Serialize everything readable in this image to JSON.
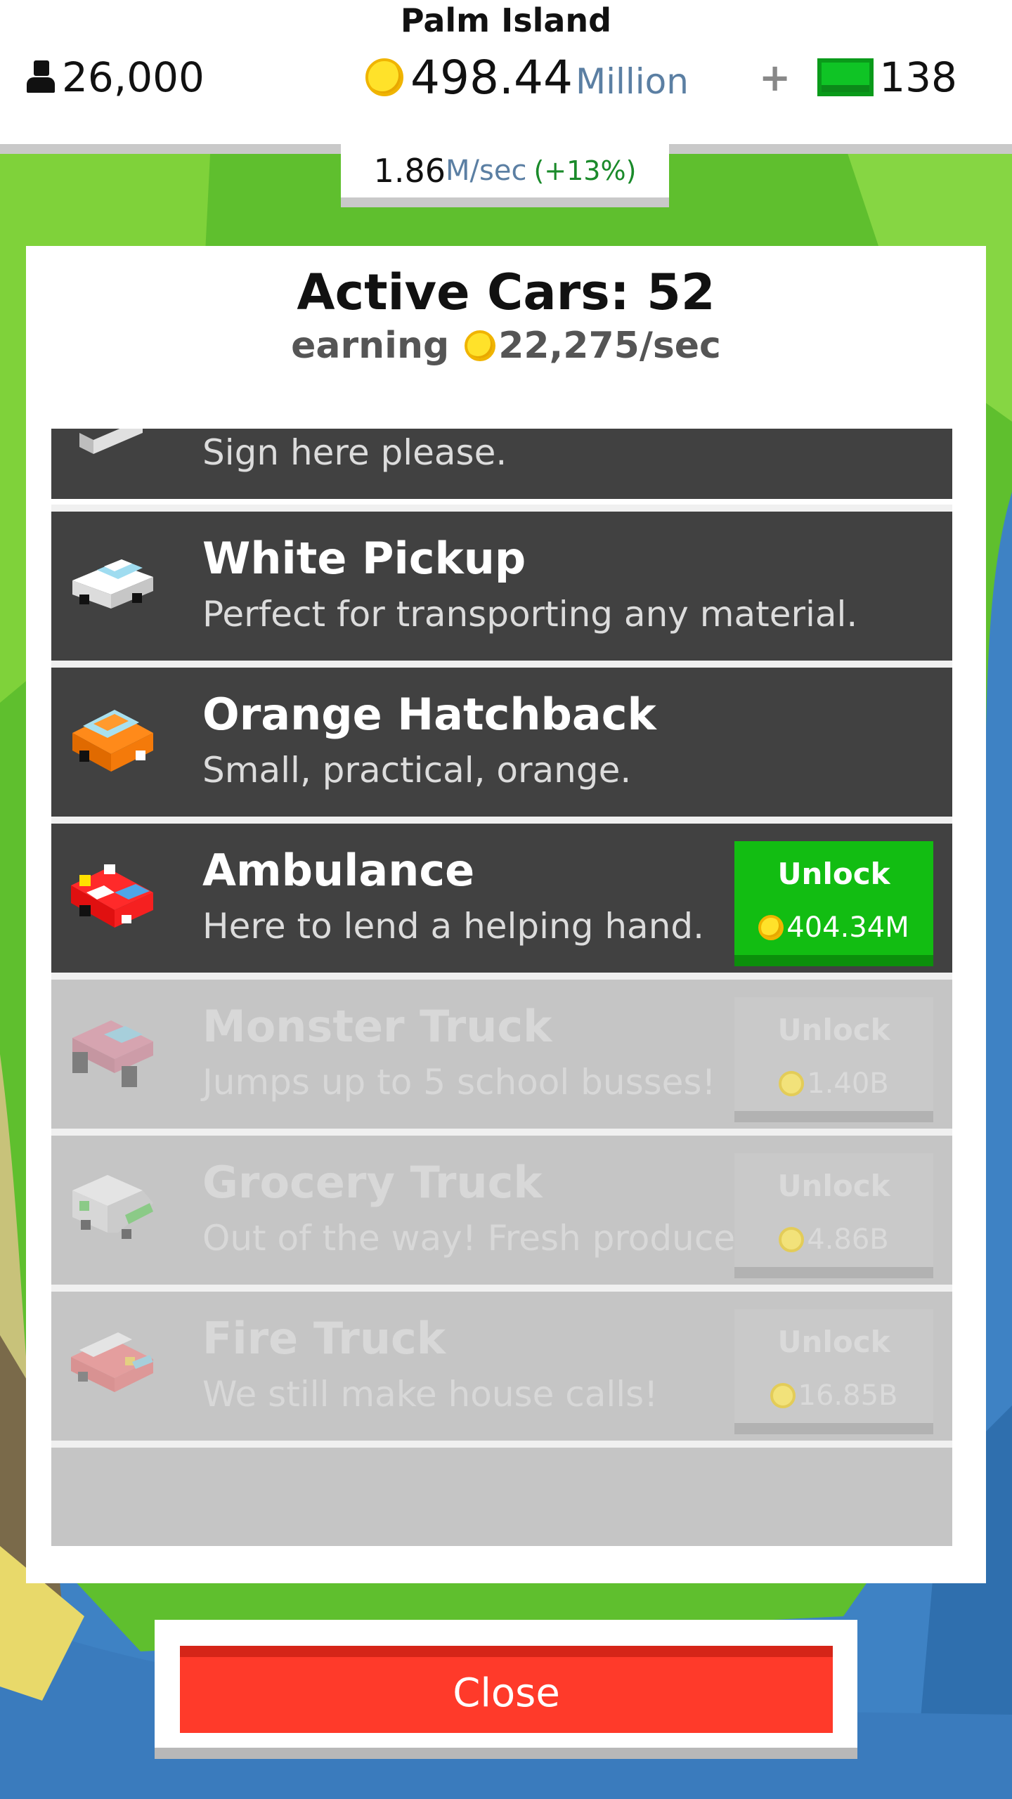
{
  "header": {
    "island_name": "Palm Island",
    "population": "26,000",
    "money_value": "498.44",
    "money_unit": "Million",
    "gems_plus": "+",
    "gems": "138"
  },
  "income": {
    "value": "1.86",
    "unit": "M/sec",
    "percent": "(+13%)"
  },
  "panel": {
    "title": "Active Cars: 52",
    "earning_label": "earning",
    "earning_value": "22,275/sec"
  },
  "cars": [
    {
      "name": "",
      "desc": "Sign here please.",
      "state": "owned",
      "icon": "sedan-icon"
    },
    {
      "name": "White Pickup",
      "desc": "Perfect for transporting any material.",
      "state": "owned",
      "icon": "white-pickup-icon"
    },
    {
      "name": "Orange Hatchback",
      "desc": "Small, practical, orange.",
      "state": "owned",
      "icon": "orange-hatchback-icon"
    },
    {
      "name": "Ambulance",
      "desc": "Here to lend a helping hand.",
      "state": "unlockable",
      "unlock_label": "Unlock",
      "price": "404.34M",
      "icon": "ambulance-icon"
    },
    {
      "name": "Monster Truck",
      "desc": "Jumps up to 5 school busses!",
      "state": "locked",
      "unlock_label": "Unlock",
      "price": "1.40B",
      "icon": "monster-truck-icon"
    },
    {
      "name": "Grocery Truck",
      "desc": "Out of the way! Fresh produce here!",
      "state": "locked",
      "unlock_label": "Unlock",
      "price": "4.86B",
      "icon": "grocery-truck-icon"
    },
    {
      "name": "Fire Truck",
      "desc": "We still make house calls!",
      "state": "locked",
      "unlock_label": "Unlock",
      "price": "16.85B",
      "icon": "fire-truck-icon"
    }
  ],
  "close_label": "Close",
  "colors": {
    "unlock_green": "#12bd12",
    "close_red": "#ff3a2a",
    "row_dark": "#414141",
    "row_locked": "#c5c5c5",
    "coin_gold": "#ffe22a"
  }
}
